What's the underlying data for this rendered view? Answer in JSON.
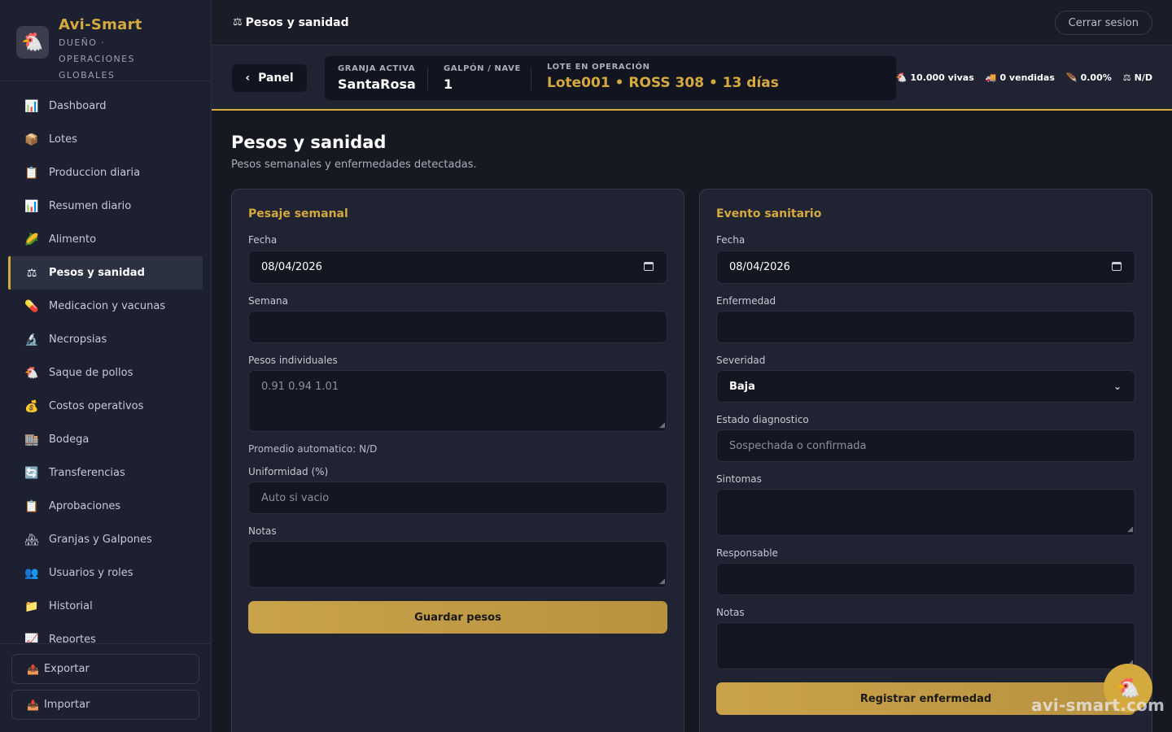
{
  "brand": {
    "title": "Avi-Smart",
    "subtitle": "DUEÑO · OPERACIONES GLOBALES",
    "logo_icon": "chicken-icon"
  },
  "sidebar": {
    "items": [
      {
        "label": "Dashboard",
        "icon": "📊"
      },
      {
        "label": "Lotes",
        "icon": "📦"
      },
      {
        "label": "Produccion diaria",
        "icon": "📋"
      },
      {
        "label": "Resumen diario",
        "icon": "📊"
      },
      {
        "label": "Alimento",
        "icon": "🌽"
      },
      {
        "label": "Pesos y sanidad",
        "icon": "⚖",
        "active": true
      },
      {
        "label": "Medicacion y vacunas",
        "icon": "💊"
      },
      {
        "label": "Necropsias",
        "icon": "🔬"
      },
      {
        "label": "Saque de pollos",
        "icon": "🐔"
      },
      {
        "label": "Costos operativos",
        "icon": "💰"
      },
      {
        "label": "Bodega",
        "icon": "🏬"
      },
      {
        "label": "Transferencias",
        "icon": "🔄"
      },
      {
        "label": "Aprobaciones",
        "icon": "📋"
      },
      {
        "label": "Granjas y Galpones",
        "icon": "🏘"
      },
      {
        "label": "Usuarios y roles",
        "icon": "👥"
      },
      {
        "label": "Historial",
        "icon": "📁"
      },
      {
        "label": "Reportes",
        "icon": "📈"
      }
    ],
    "export_label": "Exportar",
    "import_label": "Importar"
  },
  "header": {
    "title": "Pesos y sanidad",
    "title_icon": "⚖",
    "logout_label": "Cerrar sesion"
  },
  "context": {
    "panel_label": "Panel",
    "farm_label": "GRANJA ACTIVA",
    "farm_value": "SantaRosa",
    "barn_label": "GALPÓN / NAVE",
    "barn_value": "1",
    "lot_label": "LOTE EN OPERACIÓN",
    "lot_value": "Lote001 • ROSS 308 • 13 días",
    "stats": {
      "alive": "10.000 vivas",
      "sold": "0 vendidas",
      "mortality": "0.00%",
      "weight": "N/D"
    }
  },
  "main": {
    "title": "Pesos y sanidad",
    "subtitle": "Pesos semanales y enfermedades detectadas."
  },
  "weighing": {
    "title": "Pesaje semanal",
    "date_label": "Fecha",
    "date_value": "08/04/2026",
    "week_label": "Semana",
    "week_value": "",
    "weights_label": "Pesos individuales",
    "weights_placeholder": "0.91 0.94 1.01",
    "average_text": "Promedio automatico: N/D",
    "uniformity_label": "Uniformidad (%)",
    "uniformity_placeholder": "Auto si vacio",
    "notes_label": "Notas",
    "save_label": "Guardar pesos"
  },
  "health": {
    "title": "Evento sanitario",
    "date_label": "Fecha",
    "date_value": "08/04/2026",
    "disease_label": "Enfermedad",
    "severity_label": "Severidad",
    "severity_value": "Baja",
    "diagnosis_label": "Estado diagnostico",
    "diagnosis_placeholder": "Sospechada o confirmada",
    "symptoms_label": "Sintomas",
    "responsible_label": "Responsable",
    "notes_label": "Notas",
    "submit_label": "Registrar enfermedad"
  },
  "watermark": "avi-smart.com",
  "colors": {
    "accent": "#d4a93e",
    "background": "#161922",
    "panel": "#1f2332",
    "input": "#141722"
  }
}
